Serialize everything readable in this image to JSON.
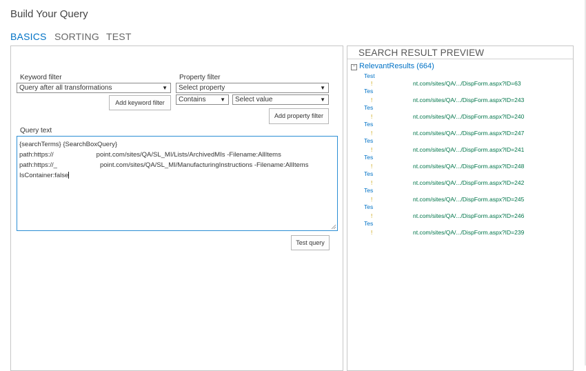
{
  "page": {
    "title": "Build Your Query"
  },
  "tabs": [
    {
      "label": "BASICS",
      "active": true
    },
    {
      "label": "SORTING",
      "active": false
    },
    {
      "label": "TEST",
      "active": false
    }
  ],
  "keyword_filter": {
    "label": "Keyword filter",
    "selected": "Query after all transformations",
    "button_label": "Add keyword filter"
  },
  "property_filter": {
    "label": "Property filter",
    "property_selected": "Select property",
    "operator_selected": "Contains",
    "value_selected": "Select value",
    "button_label": "Add property filter"
  },
  "query_text": {
    "label": "Query text",
    "line1": "{searchTerms} {SearchBoxQuery}",
    "line2_a": "path:https://",
    "line2_b": "point.com/sites/QA/SL_MI/Lists/ArchivedMIs -Filename:AllItems",
    "line3_a": "path:https://_",
    "line3_b": "point.com/sites/QA/SL_MI/ManufacturingInstructions -Filename:AllItems",
    "line4": "IsContainer:false"
  },
  "test_query_button": "Test query",
  "preview": {
    "title": "SEARCH RESULT PREVIEW",
    "group_label": "RelevantResults (664)",
    "results": [
      {
        "title": "Test",
        "url": "nt.com/sites/QA/.../DispForm.aspx?ID=63"
      },
      {
        "title": "Tes",
        "url": "nt.com/sites/QA/.../DispForm.aspx?ID=243"
      },
      {
        "title": "Tes",
        "url": "nt.com/sites/QA/.../DispForm.aspx?ID=240"
      },
      {
        "title": "Tes",
        "url": "nt.com/sites/QA/.../DispForm.aspx?ID=247"
      },
      {
        "title": "Tes",
        "url": "nt.com/sites/QA/.../DispForm.aspx?ID=241"
      },
      {
        "title": "Tes",
        "url": "nt.com/sites/QA/.../DispForm.aspx?ID=248"
      },
      {
        "title": "Tes",
        "url": "nt.com/sites/QA/.../DispForm.aspx?ID=242"
      },
      {
        "title": "Tes",
        "url": "nt.com/sites/QA/.../DispForm.aspx?ID=245"
      },
      {
        "title": "Tes",
        "url": "nt.com/sites/QA/.../DispForm.aspx?ID=246"
      },
      {
        "title": "Tes",
        "url": "nt.com/sites/QA/.../DispForm.aspx?ID=239"
      }
    ],
    "bang": "!"
  },
  "icons": {
    "dropdown": "caret-down-icon",
    "collapse": "minus-box-icon",
    "resize": "resize-grip-icon"
  },
  "colors": {
    "accent": "#0072c6",
    "url_green": "#00754a",
    "focus_border": "#2a8dd4"
  }
}
